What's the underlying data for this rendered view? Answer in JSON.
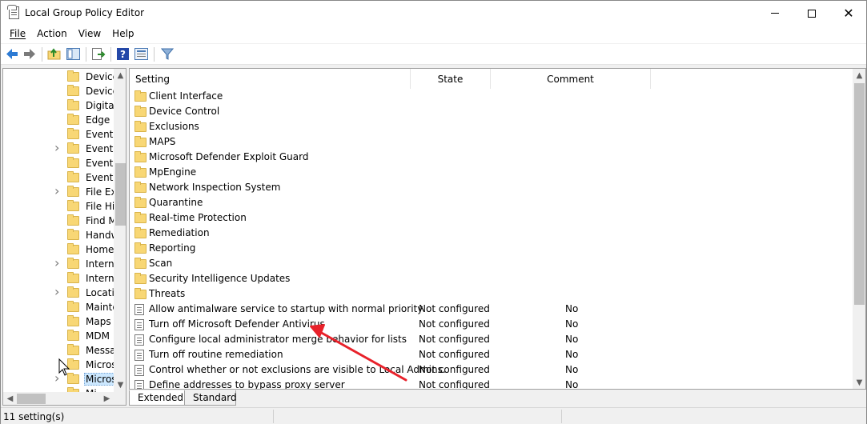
{
  "window": {
    "title": "Local Group Policy Editor"
  },
  "menu": [
    "File",
    "Action",
    "View",
    "Help"
  ],
  "tree": [
    {
      "label": "Device",
      "arrow": false
    },
    {
      "label": "Device",
      "arrow": false
    },
    {
      "label": "Digital",
      "arrow": false
    },
    {
      "label": "Edge U",
      "arrow": false
    },
    {
      "label": "Event F",
      "arrow": false
    },
    {
      "label": "Event L",
      "arrow": true
    },
    {
      "label": "Event L",
      "arrow": false
    },
    {
      "label": "Event V",
      "arrow": false
    },
    {
      "label": "File Exp",
      "arrow": true
    },
    {
      "label": "File His",
      "arrow": false
    },
    {
      "label": "Find M",
      "arrow": false
    },
    {
      "label": "Handw",
      "arrow": false
    },
    {
      "label": "HomeG",
      "arrow": false
    },
    {
      "label": "Interne",
      "arrow": true
    },
    {
      "label": "Interne",
      "arrow": false
    },
    {
      "label": "Locatio",
      "arrow": true
    },
    {
      "label": "Mainte",
      "arrow": false
    },
    {
      "label": "Maps",
      "arrow": false
    },
    {
      "label": "MDM",
      "arrow": false
    },
    {
      "label": "Messag",
      "arrow": false
    },
    {
      "label": "Micros",
      "arrow": false
    },
    {
      "label": "Micros",
      "arrow": true,
      "selected": true
    },
    {
      "label": "Mi",
      "arrow": false
    }
  ],
  "columns": {
    "setting": "Setting",
    "state": "State",
    "comment": "Comment"
  },
  "rows": [
    {
      "type": "folder",
      "name": "Client Interface",
      "state": "",
      "comment": ""
    },
    {
      "type": "folder",
      "name": "Device Control",
      "state": "",
      "comment": ""
    },
    {
      "type": "folder",
      "name": "Exclusions",
      "state": "",
      "comment": ""
    },
    {
      "type": "folder",
      "name": "MAPS",
      "state": "",
      "comment": ""
    },
    {
      "type": "folder",
      "name": "Microsoft Defender Exploit Guard",
      "state": "",
      "comment": ""
    },
    {
      "type": "folder",
      "name": "MpEngine",
      "state": "",
      "comment": ""
    },
    {
      "type": "folder",
      "name": "Network Inspection System",
      "state": "",
      "comment": ""
    },
    {
      "type": "folder",
      "name": "Quarantine",
      "state": "",
      "comment": ""
    },
    {
      "type": "folder",
      "name": "Real-time Protection",
      "state": "",
      "comment": ""
    },
    {
      "type": "folder",
      "name": "Remediation",
      "state": "",
      "comment": ""
    },
    {
      "type": "folder",
      "name": "Reporting",
      "state": "",
      "comment": ""
    },
    {
      "type": "folder",
      "name": "Scan",
      "state": "",
      "comment": ""
    },
    {
      "type": "folder",
      "name": "Security Intelligence Updates",
      "state": "",
      "comment": ""
    },
    {
      "type": "folder",
      "name": "Threats",
      "state": "",
      "comment": ""
    },
    {
      "type": "policy",
      "name": "Allow antimalware service to startup with normal priority",
      "state": "Not configured",
      "comment": "No"
    },
    {
      "type": "policy",
      "name": "Turn off Microsoft Defender Antivirus",
      "state": "Not configured",
      "comment": "No"
    },
    {
      "type": "policy",
      "name": "Configure local administrator merge behavior for lists",
      "state": "Not configured",
      "comment": "No"
    },
    {
      "type": "policy",
      "name": "Turn off routine remediation",
      "state": "Not configured",
      "comment": "No"
    },
    {
      "type": "policy",
      "name": "Control whether or not exclusions are visible to Local Admins.",
      "state": "Not configured",
      "comment": "No"
    },
    {
      "type": "policy",
      "name": "Define addresses to bypass proxy server",
      "state": "Not configured",
      "comment": "No"
    }
  ],
  "tabs": {
    "extended": "Extended",
    "standard": "Standard"
  },
  "status": {
    "text": "11 setting(s)"
  },
  "colors": {
    "arrow": "#e8212a",
    "folder": "#f8d775",
    "selection": "#cce8ff"
  }
}
